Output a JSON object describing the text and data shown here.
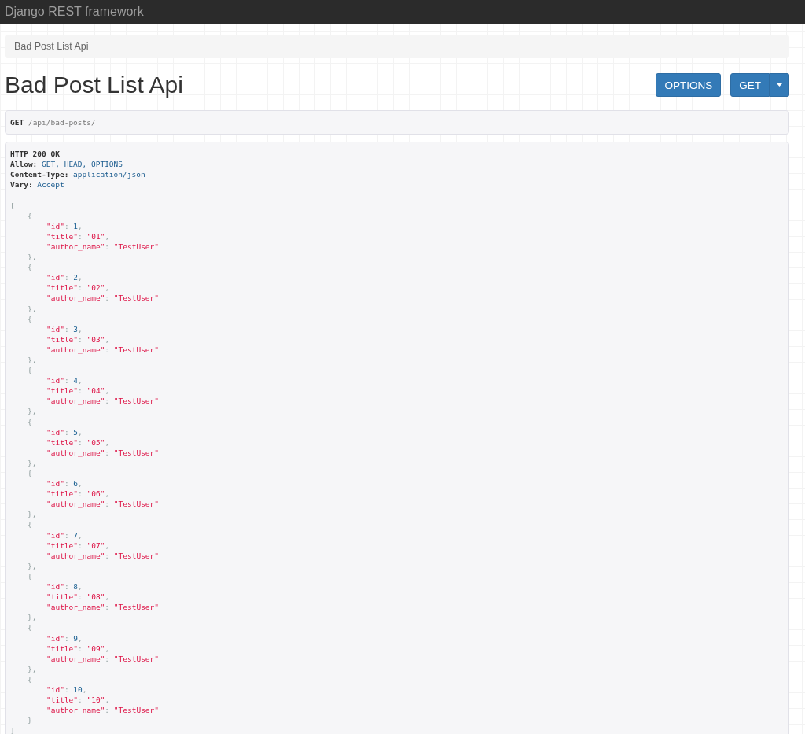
{
  "navbar": {
    "brand": "Django REST framework"
  },
  "breadcrumb": [
    "Bad Post List Api"
  ],
  "title": "Bad Post List Api",
  "buttons": {
    "options": "OPTIONS",
    "get": "GET"
  },
  "request": {
    "method": "GET",
    "path": "/api/bad-posts/"
  },
  "response": {
    "status": "HTTP 200 OK",
    "headers": [
      {
        "name": "Allow:",
        "value": "GET, HEAD, OPTIONS"
      },
      {
        "name": "Content-Type:",
        "value": "application/json"
      },
      {
        "name": "Vary:",
        "value": "Accept"
      }
    ],
    "body": {
      "open": "[",
      "close": "]",
      "items": [
        {
          "open": "{",
          "close": "},",
          "fields": [
            {
              "key": "\"id\"",
              "colon": ":",
              "value": "1",
              "kind": "number",
              "comma": ","
            },
            {
              "key": "\"title\"",
              "colon": ":",
              "value": "\"01\"",
              "kind": "string",
              "comma": ","
            },
            {
              "key": "\"author_name\"",
              "colon": ":",
              "value": "\"TestUser\"",
              "kind": "string"
            }
          ]
        },
        {
          "open": "{",
          "close": "},",
          "fields": [
            {
              "key": "\"id\"",
              "colon": ":",
              "value": "2",
              "kind": "number",
              "comma": ","
            },
            {
              "key": "\"title\"",
              "colon": ":",
              "value": "\"02\"",
              "kind": "string",
              "comma": ","
            },
            {
              "key": "\"author_name\"",
              "colon": ":",
              "value": "\"TestUser\"",
              "kind": "string"
            }
          ]
        },
        {
          "open": "{",
          "close": "},",
          "fields": [
            {
              "key": "\"id\"",
              "colon": ":",
              "value": "3",
              "kind": "number",
              "comma": ","
            },
            {
              "key": "\"title\"",
              "colon": ":",
              "value": "\"03\"",
              "kind": "string",
              "comma": ","
            },
            {
              "key": "\"author_name\"",
              "colon": ":",
              "value": "\"TestUser\"",
              "kind": "string"
            }
          ]
        },
        {
          "open": "{",
          "close": "},",
          "fields": [
            {
              "key": "\"id\"",
              "colon": ":",
              "value": "4",
              "kind": "number",
              "comma": ","
            },
            {
              "key": "\"title\"",
              "colon": ":",
              "value": "\"04\"",
              "kind": "string",
              "comma": ","
            },
            {
              "key": "\"author_name\"",
              "colon": ":",
              "value": "\"TestUser\"",
              "kind": "string"
            }
          ]
        },
        {
          "open": "{",
          "close": "},",
          "fields": [
            {
              "key": "\"id\"",
              "colon": ":",
              "value": "5",
              "kind": "number",
              "comma": ","
            },
            {
              "key": "\"title\"",
              "colon": ":",
              "value": "\"05\"",
              "kind": "string",
              "comma": ","
            },
            {
              "key": "\"author_name\"",
              "colon": ":",
              "value": "\"TestUser\"",
              "kind": "string"
            }
          ]
        },
        {
          "open": "{",
          "close": "},",
          "fields": [
            {
              "key": "\"id\"",
              "colon": ":",
              "value": "6",
              "kind": "number",
              "comma": ","
            },
            {
              "key": "\"title\"",
              "colon": ":",
              "value": "\"06\"",
              "kind": "string",
              "comma": ","
            },
            {
              "key": "\"author_name\"",
              "colon": ":",
              "value": "\"TestUser\"",
              "kind": "string"
            }
          ]
        },
        {
          "open": "{",
          "close": "},",
          "fields": [
            {
              "key": "\"id\"",
              "colon": ":",
              "value": "7",
              "kind": "number",
              "comma": ","
            },
            {
              "key": "\"title\"",
              "colon": ":",
              "value": "\"07\"",
              "kind": "string",
              "comma": ","
            },
            {
              "key": "\"author_name\"",
              "colon": ":",
              "value": "\"TestUser\"",
              "kind": "string"
            }
          ]
        },
        {
          "open": "{",
          "close": "},",
          "fields": [
            {
              "key": "\"id\"",
              "colon": ":",
              "value": "8",
              "kind": "number",
              "comma": ","
            },
            {
              "key": "\"title\"",
              "colon": ":",
              "value": "\"08\"",
              "kind": "string",
              "comma": ","
            },
            {
              "key": "\"author_name\"",
              "colon": ":",
              "value": "\"TestUser\"",
              "kind": "string"
            }
          ]
        },
        {
          "open": "{",
          "close": "},",
          "fields": [
            {
              "key": "\"id\"",
              "colon": ":",
              "value": "9",
              "kind": "number",
              "comma": ","
            },
            {
              "key": "\"title\"",
              "colon": ":",
              "value": "\"09\"",
              "kind": "string",
              "comma": ","
            },
            {
              "key": "\"author_name\"",
              "colon": ":",
              "value": "\"TestUser\"",
              "kind": "string"
            }
          ]
        },
        {
          "open": "{",
          "close": "}",
          "fields": [
            {
              "key": "\"id\"",
              "colon": ":",
              "value": "10",
              "kind": "number",
              "comma": ","
            },
            {
              "key": "\"title\"",
              "colon": ":",
              "value": "\"10\"",
              "kind": "string",
              "comma": ","
            },
            {
              "key": "\"author_name\"",
              "colon": ":",
              "value": "\"TestUser\"",
              "kind": "string"
            }
          ]
        }
      ]
    }
  }
}
